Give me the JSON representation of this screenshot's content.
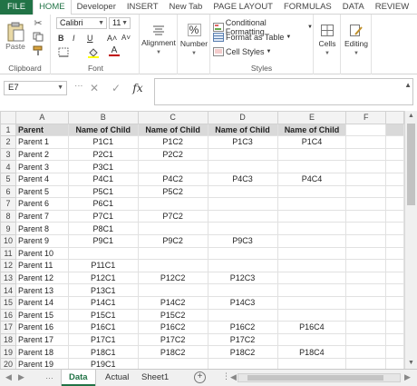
{
  "ribbon_tabs": [
    "FILE",
    "HOME",
    "Developer",
    "INSERT",
    "New Tab",
    "PAGE LAYOUT",
    "FORMULAS",
    "DATA",
    "REVIEW"
  ],
  "clipboard": {
    "paste_label": "Paste",
    "group_label": "Clipboard"
  },
  "font": {
    "name": "Calibri",
    "size": "11",
    "bold": "B",
    "italic": "I",
    "underline": "U",
    "grow": "A˄",
    "shrink": "A˅",
    "color_letter": "A",
    "group_label": "Font"
  },
  "alignment": {
    "label": "Alignment"
  },
  "number": {
    "label": "Number",
    "symbol": "%"
  },
  "styles": {
    "conditional_formatting": "Conditional Formatting",
    "format_as_table": "Format as Table",
    "cell_styles": "Cell Styles",
    "group_label": "Styles"
  },
  "cells": {
    "label": "Cells"
  },
  "editing": {
    "label": "Editing"
  },
  "formula_bar": {
    "name_box": "E7",
    "fx": "fx",
    "cancel": "✕",
    "enter": "✓",
    "value": ""
  },
  "columns": [
    "A",
    "B",
    "C",
    "D",
    "E",
    "F"
  ],
  "header_row": [
    "Parent",
    "Name of Child",
    "Name of Child",
    "Name of Child",
    "Name of Child",
    ""
  ],
  "rows": [
    [
      "Parent 1",
      "P1C1",
      "P1C2",
      "P1C3",
      "P1C4",
      ""
    ],
    [
      "Parent 2",
      "P2C1",
      "P2C2",
      "",
      "",
      ""
    ],
    [
      "Parent 3",
      "P3C1",
      "",
      "",
      "",
      ""
    ],
    [
      "Parent 4",
      "P4C1",
      "P4C2",
      "P4C3",
      "P4C4",
      ""
    ],
    [
      "Parent 5",
      "P5C1",
      "P5C2",
      "",
      "",
      ""
    ],
    [
      "Parent 6",
      "P6C1",
      "",
      "",
      "",
      ""
    ],
    [
      "Parent 7",
      "P7C1",
      "P7C2",
      "",
      "",
      ""
    ],
    [
      "Parent 8",
      "P8C1",
      "",
      "",
      "",
      ""
    ],
    [
      "Parent 9",
      "P9C1",
      "P9C2",
      "P9C3",
      "",
      ""
    ],
    [
      "Parent 10",
      "",
      "",
      "",
      "",
      ""
    ],
    [
      "Parent 11",
      "P11C1",
      "",
      "",
      "",
      ""
    ],
    [
      "Parent 12",
      "P12C1",
      "P12C2",
      "P12C3",
      "",
      ""
    ],
    [
      "Parent 13",
      "P13C1",
      "",
      "",
      "",
      ""
    ],
    [
      "Parent 14",
      "P14C1",
      "P14C2",
      "P14C3",
      "",
      ""
    ],
    [
      "Parent 15",
      "P15C1",
      "P15C2",
      "",
      "",
      ""
    ],
    [
      "Parent 16",
      "P16C1",
      "P16C2",
      "P16C2",
      "P16C4",
      ""
    ],
    [
      "Parent 17",
      "P17C1",
      "P17C2",
      "P17C2",
      "",
      ""
    ],
    [
      "Parent 18",
      "P18C1",
      "P18C2",
      "P18C2",
      "P18C4",
      ""
    ],
    [
      "Parent 19",
      "P19C1",
      "",
      "",
      "",
      ""
    ]
  ],
  "sheet_tabs": [
    "Data",
    "Actual",
    "Sheet1"
  ],
  "active_sheet": "Data",
  "colors": {
    "accent": "#217346",
    "header_fill": "#d9d9d9"
  }
}
